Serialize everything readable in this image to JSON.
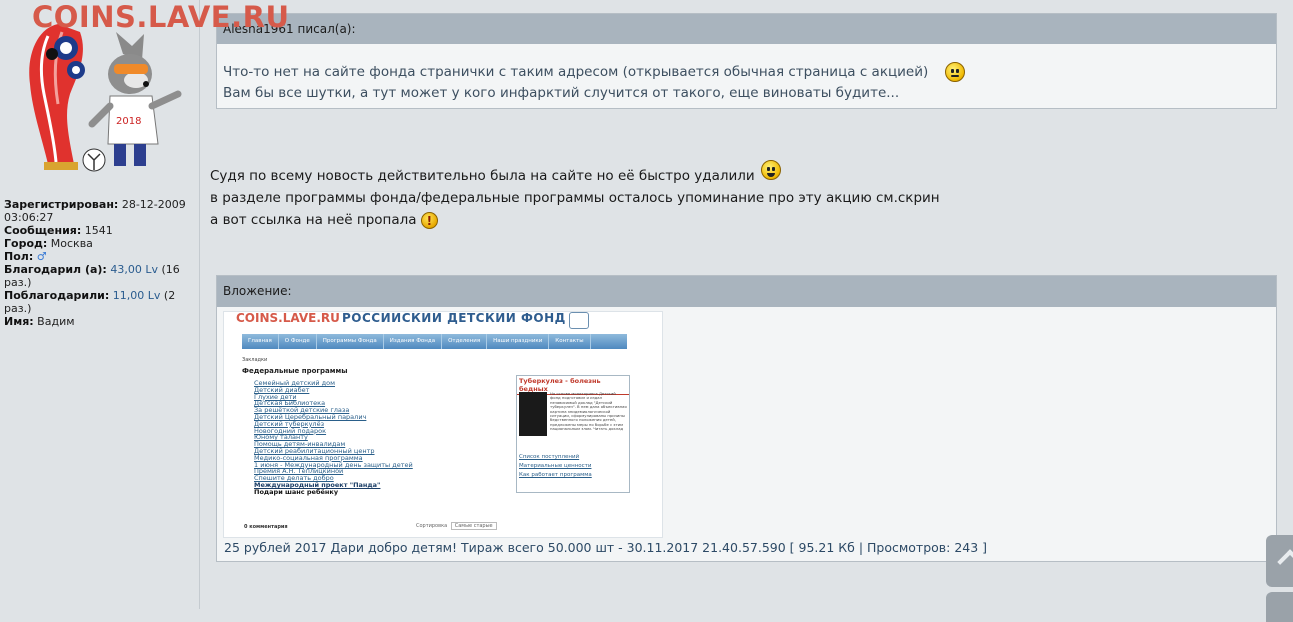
{
  "site": {
    "watermark": "COINS.LAVE.RU"
  },
  "profile": {
    "registered_label": "Зарегистрирован:",
    "registered_value": "28-12-2009 03:06:27",
    "messages_label": "Сообщения:",
    "messages_value": "1541",
    "city_label": "Город:",
    "city_value": "Москва",
    "gender_label": "Пол:",
    "thanked_label": "Благодарил (а):",
    "thanked_value": "43,00 Lv",
    "thanked_count": "(16 раз.)",
    "thanked_by_label": "Поблагодарили:",
    "thanked_by_value": "11,00 Lv",
    "thanked_by_count": "(2 раз.)",
    "name_label": "Имя:",
    "name_value": "Вадим"
  },
  "quote": {
    "author": "Alesha1961 писал(а):",
    "line1": "Что-то нет на сайте фонда странички с таким адресом (открывается обычная страница с акцией)",
    "line2": "Вам бы все шутки, а тут может у кого инфарктий случится от такого, еще виноваты будите..."
  },
  "post": {
    "line1": "Судя по всему новость действительно была на сайте но её быстро удалили",
    "line2": "в разделе программы фонда/федеральные программы осталось упоминание про эту акцию см.скрин",
    "line3": "а вот ссылка на неё пропала"
  },
  "attachment": {
    "header": "Вложение:",
    "caption": "25 рублей 2017 Дари добро детям! Тираж всего 50.000 шт - 30.11.2017 21.40.57.590 [ 95.21 Кб | Просмотров: 243 ]",
    "thumbnail": {
      "watermark": "COINS.LAVE.RU",
      "title": "РОССИЙСКИЙ  ДЕТСКИЙ  ФОНД",
      "nav": [
        "Главная",
        "О Фонде",
        "Программы Фонда",
        "Издания Фонда",
        "Отделения",
        "Наши праздники",
        "Контакты"
      ],
      "bookmark": "Закладки",
      "heading": "Федеральные программы",
      "list": [
        "Семейный детский дом",
        "Детский диабет",
        "Глухие дети",
        "Детская Библиотека",
        "За решёткой детские глаза",
        "Детский Церебральный паралич",
        "Детский туберкулёз",
        "Новогодний подарок",
        "Юному таланту",
        "Помощь детям-инвалидам",
        "Детский реабилитационный центр",
        "Медико-социальная программа",
        "1 июня - Международный день защиты детей",
        "Премия А.Н. Теплицкиной",
        "Спешите делать добро",
        "Международный проект \"Панда\"",
        "Подари шанс ребёнку"
      ],
      "box_title": "Туберкулез - болезнь бедных",
      "box_text": "На основе мониторинга Детский фонд подготовил и издал независимый доклад \"Детский туберкулез\". В нем дана объективная картина эпидемиологической ситуации, сформулированы причины бедственного положения детей, предложены меры по борьбе с этим национальным злом. Читать доклад",
      "box_links": [
        "Список поступлений",
        "Материальные ценности",
        "Как работает программа"
      ],
      "footer_comments": "0 комментария",
      "footer_sort_label": "Сортировка",
      "footer_sort_value": "Самые старые"
    }
  },
  "icons": {
    "smiley": "smiley-icon",
    "laugh": "laughing-smiley-icon",
    "warning": "exclamation-smiley-icon",
    "scroll": "scroll-up-icon"
  }
}
